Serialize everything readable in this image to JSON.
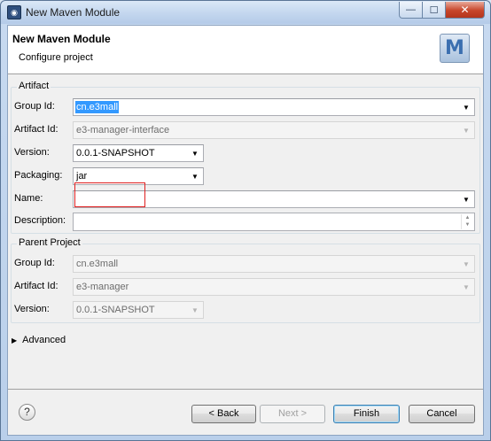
{
  "window": {
    "title": "New Maven Module",
    "icon": "eclipse-maven-icon",
    "controls": {
      "minimize": "—",
      "maximize": "☐",
      "close": "✕"
    }
  },
  "header": {
    "title": "New Maven Module",
    "subtitle": "Configure project",
    "logo_text": "M"
  },
  "artifact": {
    "legend": "Artifact",
    "group_id": {
      "label": "Group Id:",
      "value": "cn.e3mall"
    },
    "artifact_id": {
      "label": "Artifact Id:",
      "value": "e3-manager-interface"
    },
    "version": {
      "label": "Version:",
      "value": "0.0.1-SNAPSHOT"
    },
    "packaging": {
      "label": "Packaging:",
      "value": "jar"
    },
    "name": {
      "label": "Name:",
      "value": ""
    },
    "description": {
      "label": "Description:",
      "value": ""
    }
  },
  "parent": {
    "legend": "Parent Project",
    "group_id": {
      "label": "Group Id:",
      "value": "cn.e3mall"
    },
    "artifact_id": {
      "label": "Artifact Id:",
      "value": "e3-manager"
    },
    "version": {
      "label": "Version:",
      "value": "0.0.1-SNAPSHOT"
    }
  },
  "advanced": {
    "label": "Advanced"
  },
  "buttons": {
    "help": "?",
    "back": "< Back",
    "next": "Next >",
    "finish": "Finish",
    "cancel": "Cancel"
  },
  "colors": {
    "selection": "#3399ff",
    "annotation_box": "#e02020"
  }
}
